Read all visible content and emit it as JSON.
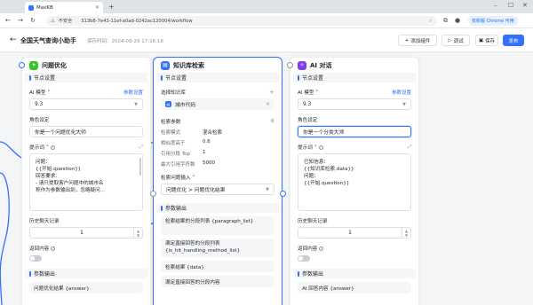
{
  "browser": {
    "tab_title": "MaxKB",
    "url_security": "不安全",
    "url_text": "313b8-7e43-11ef-a0ad-0242ac120004/workflow",
    "new_version": "有新版 Chrome 可用"
  },
  "header": {
    "title": "全国天气查询小助手",
    "save_time": "保存时间：2024-09-29 17:16:18",
    "add_component": "添加组件",
    "debug": "调试",
    "save": "保存",
    "publish": "发布"
  },
  "nodes": {
    "optimize": {
      "title": "问题优化",
      "settings": "节点设置",
      "model_label": "AI 模型",
      "model_settings": "参数设置",
      "model_value": "9.3",
      "role_label": "角色设定",
      "role_value": "你是一个问题优化大师",
      "prompt_label": "提示词",
      "prompt_lines": [
        "问题：",
        "{{开始.question}}",
        "回答要求：",
        "- 请只提取客户问题中的城市名",
        "称作为参数输出到，忽略疑问..."
      ],
      "history_label": "历史聊天记录",
      "history_value": "1",
      "return_label": "返回内容",
      "params_output": "参数输出",
      "output_1": "问题优化结果 {answer}"
    },
    "kb": {
      "title": "知识库检索",
      "settings": "节点设置",
      "kb_label": "选择知识库",
      "kb_name": "城市代码",
      "search_params": "检索参数",
      "params": [
        {
          "k": "检索模式",
          "v": "混合检索"
        },
        {
          "k": "相似度高于",
          "v": "0.6"
        },
        {
          "k": "引用分段 Top",
          "v": "1"
        },
        {
          "k": "最大引用字符数",
          "v": "5000"
        }
      ],
      "input_label": "检索问题输入",
      "input_value": "问题优化 > 问题优化结果",
      "params_output": "参数输出",
      "outputs": [
        "检索结果的分段列表 {paragraph_list}",
        "满足直接回答的分段列表 {is_hit_handling_method_list}",
        "检索结果 {data}",
        "满足直接回答的分段内容"
      ]
    },
    "ai": {
      "title": "AI 对话",
      "settings": "节点设置",
      "model_label": "AI 模型",
      "model_settings": "参数设置",
      "model_value": "9.3",
      "role_label": "角色设定",
      "role_value": "你是一个分类大师",
      "prompt_label": "提示词",
      "prompt_lines": [
        "已知信息：",
        "{{知识库检索.data}}",
        "问题：",
        "{{开始.question}}"
      ],
      "history_label": "历史聊天记录",
      "history_value": "1",
      "return_label": "返回内容",
      "params_output": "参数输出",
      "output_1": "AI 回答内容 {answer}"
    }
  },
  "colors": {
    "primary": "#3370ff",
    "optimize_icon": "#34c724",
    "kb_icon": "#3370ff",
    "ai_icon": "#7f3bf5"
  }
}
